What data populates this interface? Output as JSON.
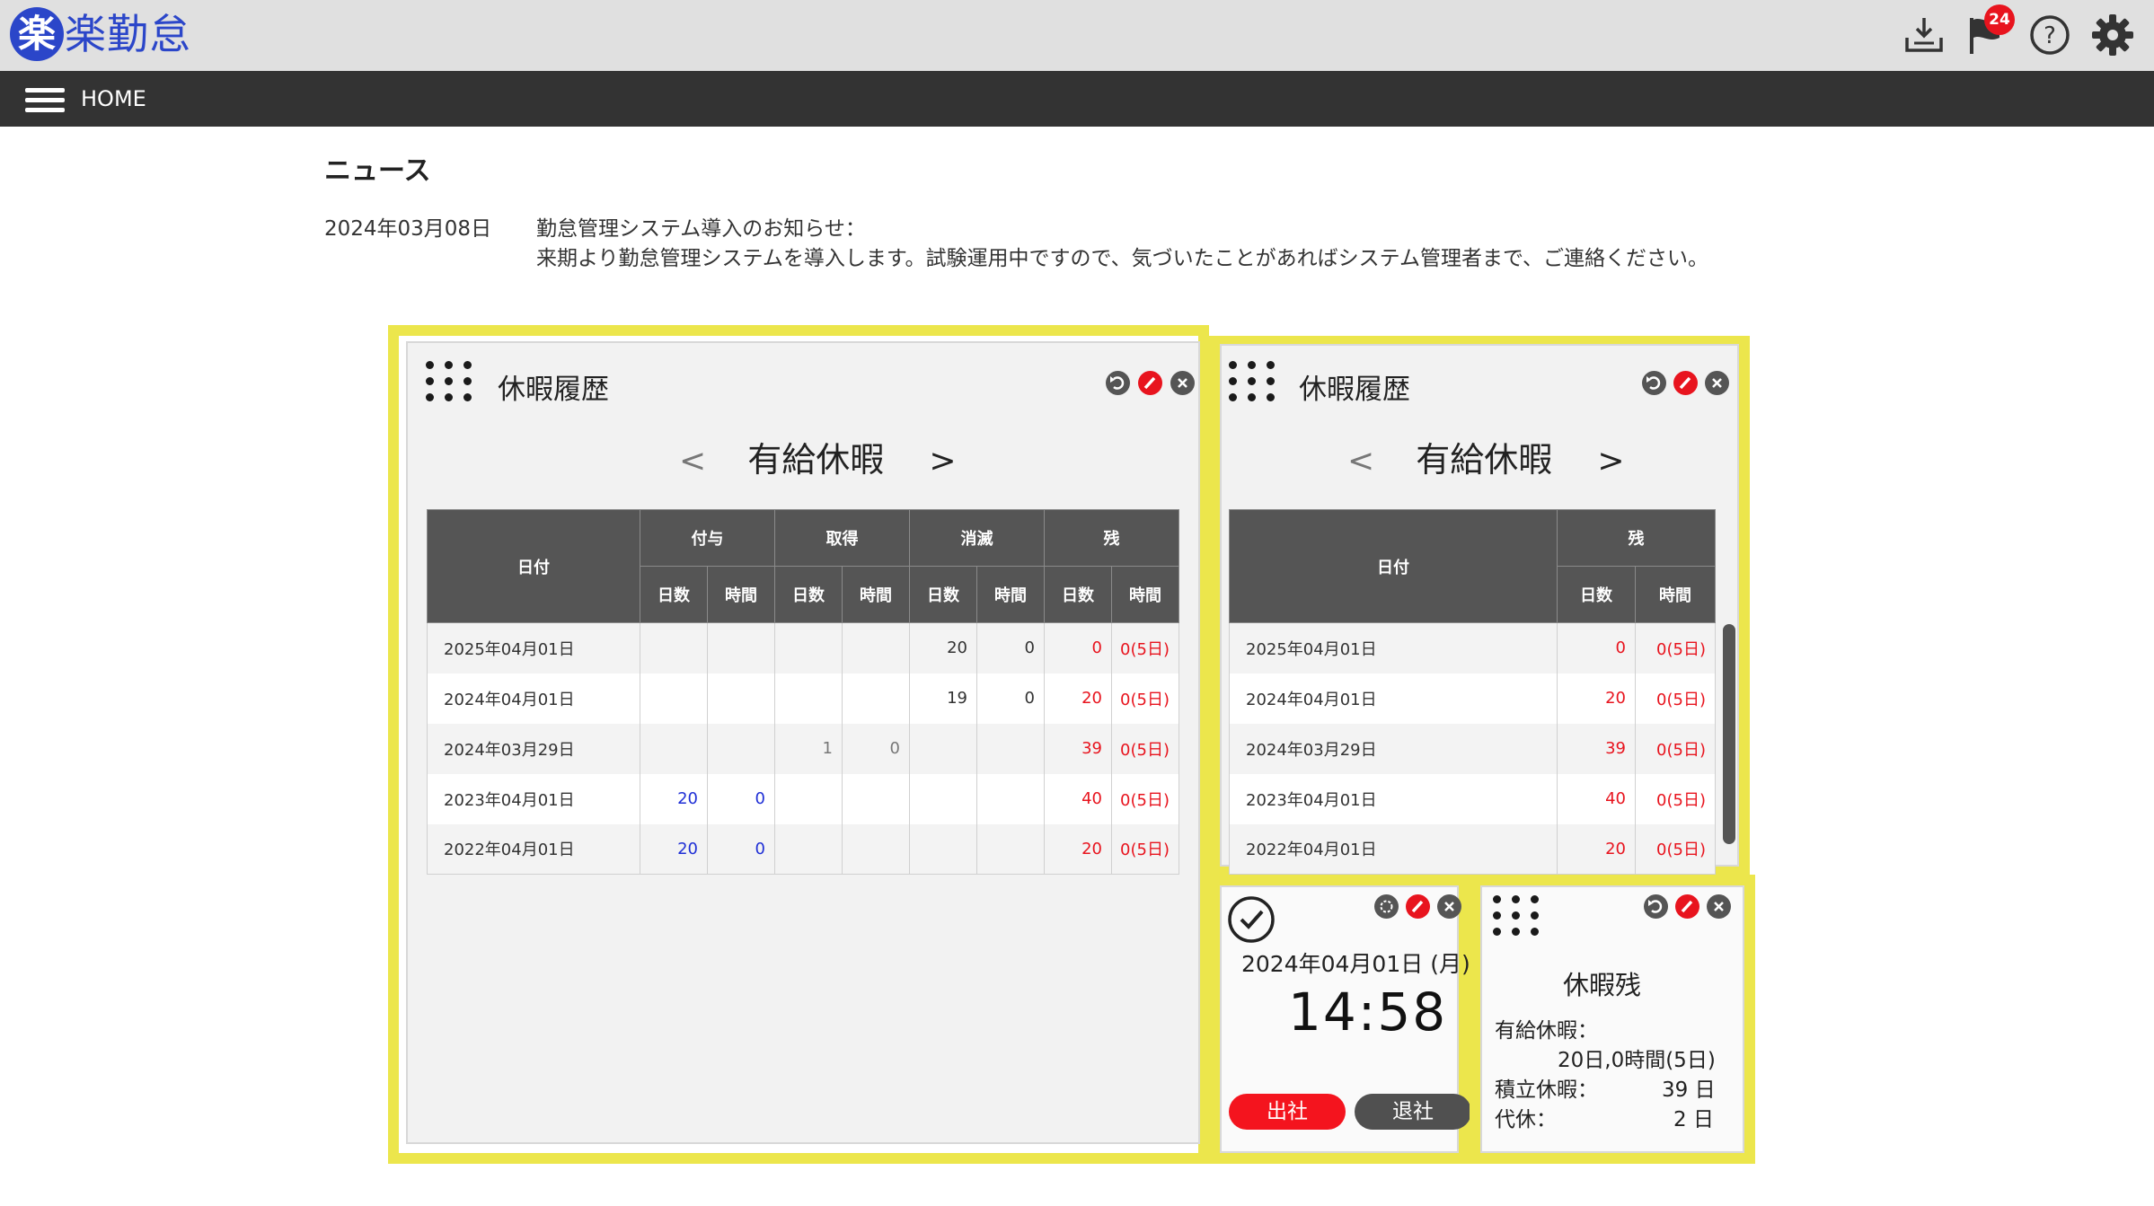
{
  "header": {
    "logo_badge": "楽",
    "logo_text": "楽勤怠",
    "notifications_count": "24",
    "icons": [
      "download-tray-icon",
      "flag-icon",
      "help-icon",
      "gear-icon"
    ]
  },
  "navbar": {
    "home_label": "HOME"
  },
  "news": {
    "title": "ニュース",
    "date": "2024年03月08日",
    "line1": "勤怠管理システム導入のお知らせ：",
    "line2": "来期より勤怠管理システムを導入します。試験運用中ですので、気づいたことがあればシステム管理者まで、ご連絡ください。"
  },
  "history_full": {
    "title": "休暇履歴",
    "leave_type": "有給休暇",
    "prev": "<",
    "next": ">",
    "headers": {
      "date": "日付",
      "groups": [
        "付与",
        "取得",
        "消滅",
        "残"
      ],
      "days": "日数",
      "hours": "時間"
    },
    "rows": [
      {
        "date": "2025年04月01日",
        "grant_days": "",
        "grant_hours": "",
        "taken_days": "",
        "taken_hours": "",
        "expired_days": "20",
        "expired_hours": "0",
        "remain_days": "0",
        "remain_hours": "0(5日)"
      },
      {
        "date": "2024年04月01日",
        "grant_days": "",
        "grant_hours": "",
        "taken_days": "",
        "taken_hours": "",
        "expired_days": "19",
        "expired_hours": "0",
        "remain_days": "20",
        "remain_hours": "0(5日)"
      },
      {
        "date": "2024年03月29日",
        "grant_days": "",
        "grant_hours": "",
        "taken_days": "1",
        "taken_hours": "0",
        "expired_days": "",
        "expired_hours": "",
        "remain_days": "39",
        "remain_hours": "0(5日)"
      },
      {
        "date": "2023年04月01日",
        "grant_days": "20",
        "grant_hours": "0",
        "taken_days": "",
        "taken_hours": "",
        "expired_days": "",
        "expired_hours": "",
        "remain_days": "40",
        "remain_hours": "0(5日)"
      },
      {
        "date": "2022年04月01日",
        "grant_days": "20",
        "grant_hours": "0",
        "taken_days": "",
        "taken_hours": "",
        "expired_days": "",
        "expired_hours": "",
        "remain_days": "20",
        "remain_hours": "0(5日)"
      }
    ]
  },
  "history_compact": {
    "title": "休暇履歴",
    "leave_type": "有給休暇",
    "prev": "<",
    "next": ">",
    "headers": {
      "date": "日付",
      "remain": "残",
      "days": "日数",
      "hours": "時間"
    },
    "rows": [
      {
        "date": "2025年04月01日",
        "remain_days": "0",
        "remain_hours": "0(5日)"
      },
      {
        "date": "2024年04月01日",
        "remain_days": "20",
        "remain_hours": "0(5日)"
      },
      {
        "date": "2024年03月29日",
        "remain_days": "39",
        "remain_hours": "0(5日)"
      },
      {
        "date": "2023年04月01日",
        "remain_days": "40",
        "remain_hours": "0(5日)"
      },
      {
        "date": "2022年04月01日",
        "remain_days": "20",
        "remain_hours": "0(5日)"
      }
    ]
  },
  "clock": {
    "date": "2024年04月01日 (月)",
    "time": "14:58",
    "clock_in": "出社",
    "clock_out": "退社"
  },
  "balance": {
    "title": "休暇残",
    "paid_label": "有給休暇：",
    "paid_value": "20日,0時間(5日)",
    "accum_label": "積立休暇：",
    "accum_value": "39 日",
    "comp_label": "代休：",
    "comp_value": "2 日"
  },
  "colors": {
    "accent_blue": "#2b46c9",
    "highlight_yellow": "#ece64c",
    "red": "#e8141e",
    "dark_header": "#333333"
  }
}
